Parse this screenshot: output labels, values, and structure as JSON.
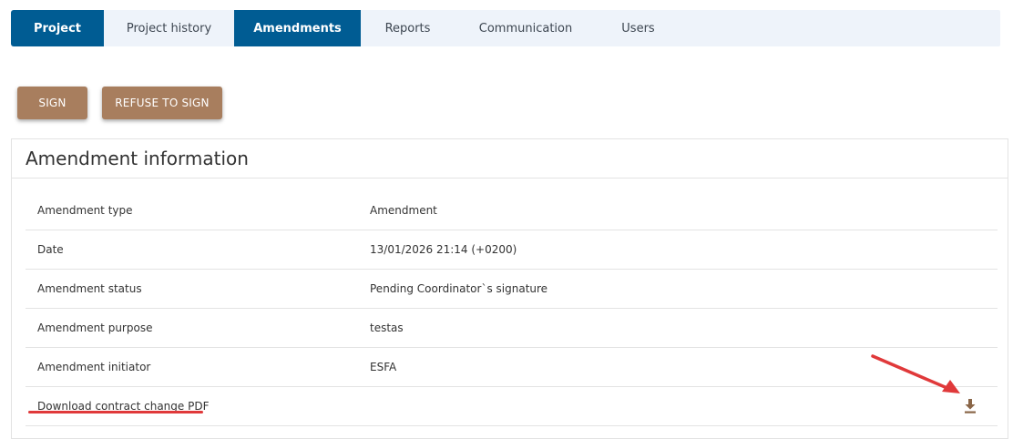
{
  "tabs": [
    {
      "label": "Project",
      "active": true
    },
    {
      "label": "Project history",
      "active": false
    },
    {
      "label": "Amendments",
      "active": true
    },
    {
      "label": "Reports",
      "active": false
    },
    {
      "label": "Communication",
      "active": false
    },
    {
      "label": "Users",
      "active": false
    }
  ],
  "actions": {
    "sign_label": "SIGN",
    "refuse_label": "REFUSE TO SIGN"
  },
  "panel": {
    "title": "Amendment information",
    "rows": [
      {
        "label": "Amendment type",
        "value": "Amendment"
      },
      {
        "label": "Date",
        "value": "13/01/2026 21:14 (+0200)"
      },
      {
        "label": "Amendment status",
        "value": "Pending Coordinator`s signature"
      },
      {
        "label": "Amendment purpose",
        "value": "testas"
      },
      {
        "label": "Amendment initiator",
        "value": "ESFA"
      },
      {
        "label": "Download contract change PDF",
        "value": ""
      }
    ],
    "download_icon": "download-icon"
  },
  "colors": {
    "active_tab": "#005c93",
    "tab_bar": "#eef3fa",
    "button": "#a87e5e",
    "annotation": "#e0393a",
    "download_icon": "#8a6648"
  }
}
